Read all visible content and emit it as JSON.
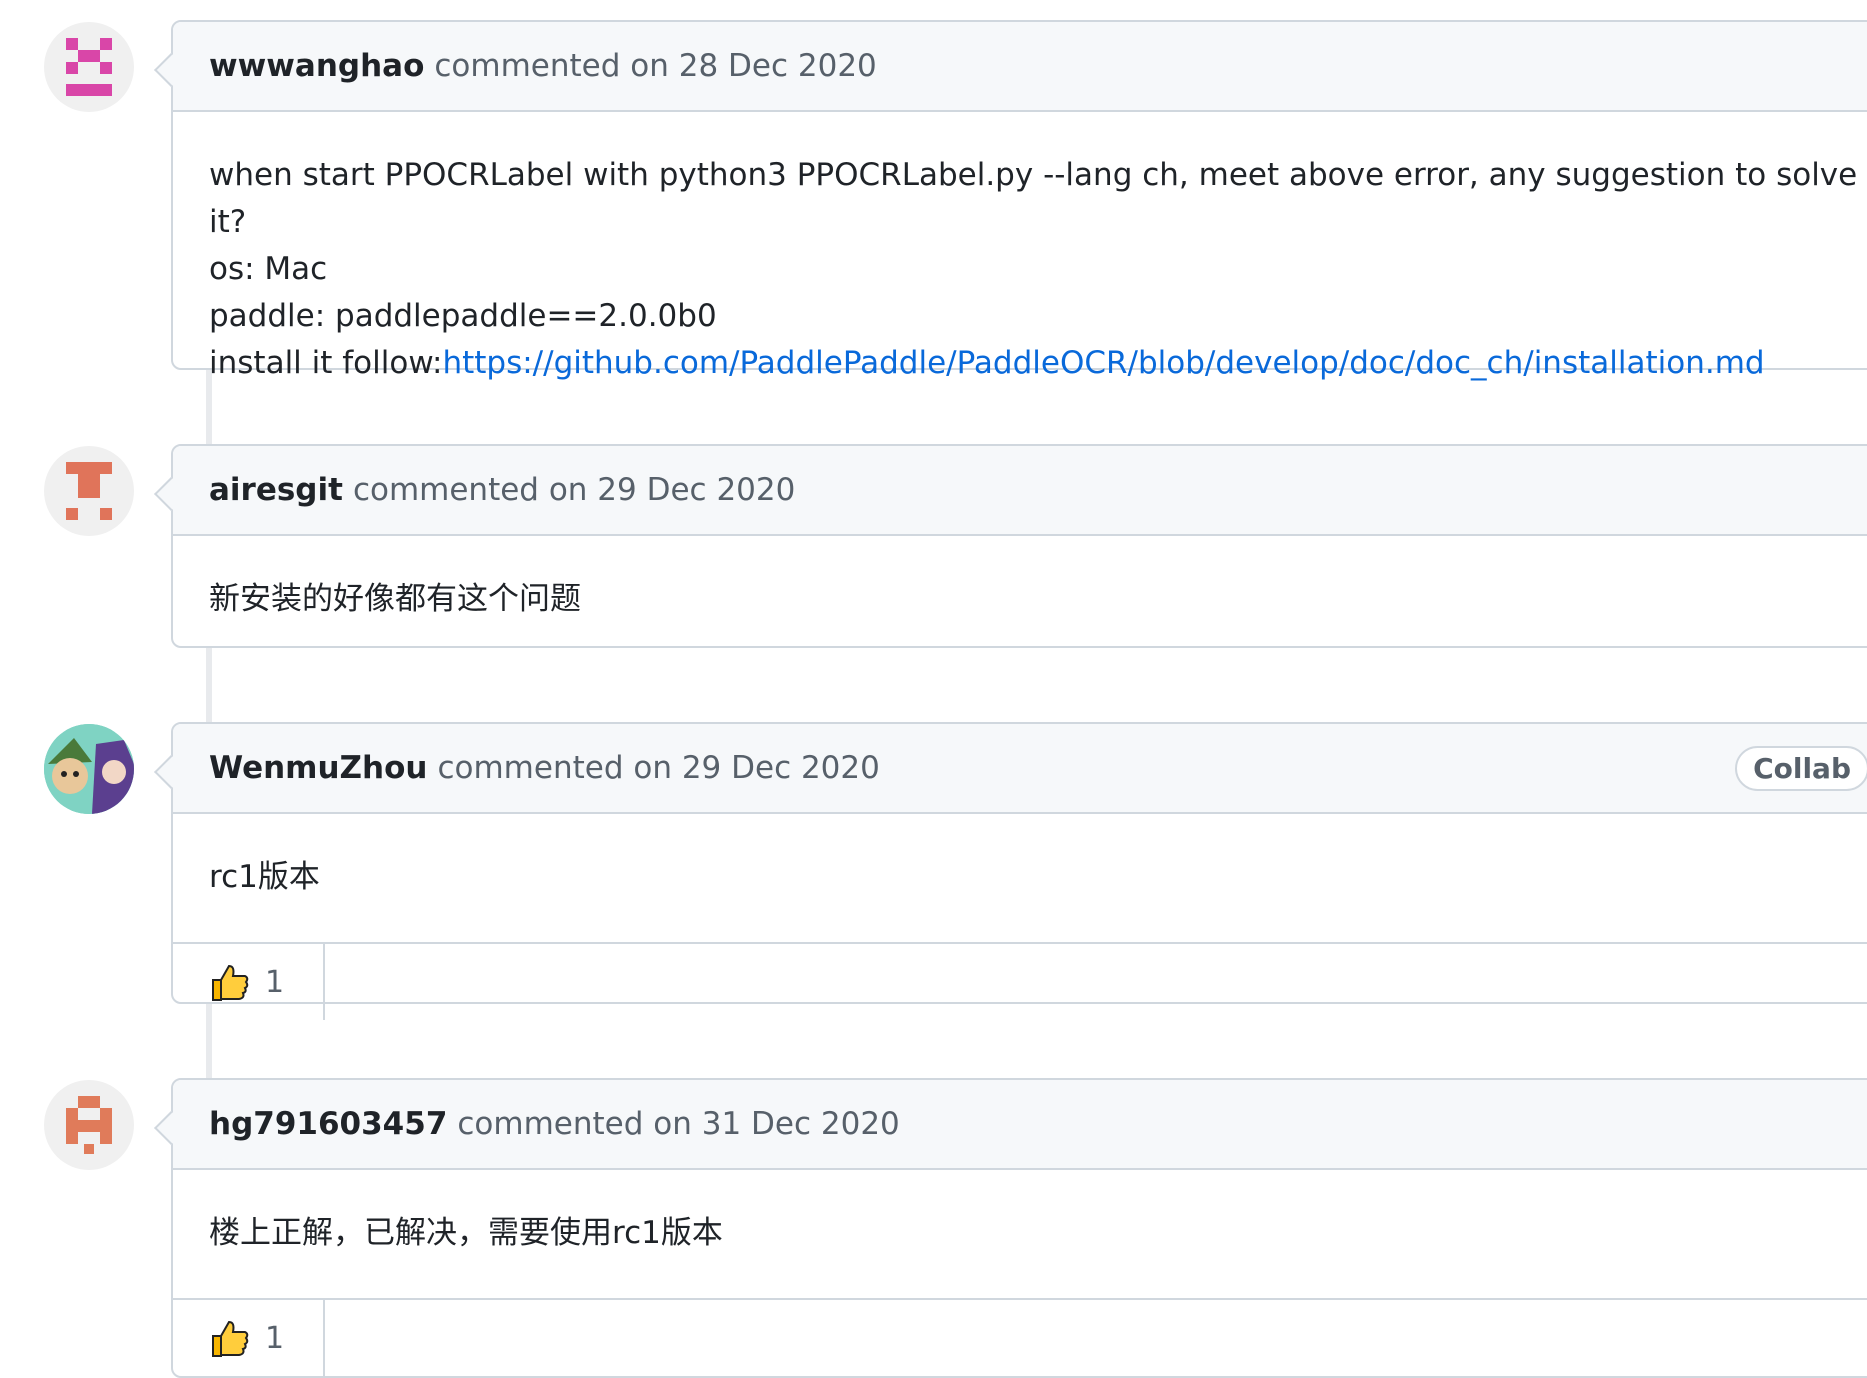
{
  "comments": [
    {
      "author": "wwwanghao",
      "meta": "commented on 28 Dec 2020",
      "body_lines": [
        "when start PPOCRLabel with python3 PPOCRLabel.py --lang ch, meet above error, any suggestion to solve it?",
        "os: Mac",
        "paddle: paddlepaddle==2.0.0b0"
      ],
      "install_prefix": "install it follow:",
      "install_link": "https://github.com/PaddlePaddle/PaddleOCR/blob/develop/doc/doc_ch/installation.md",
      "avatar_color": "#d946a8"
    },
    {
      "author": "airesgit",
      "meta": "commented on 29 Dec 2020",
      "body": "新安装的好像都有这个问题",
      "avatar_color": "#e0745a"
    },
    {
      "author": "WenmuZhou",
      "meta": "commented on 29 Dec 2020",
      "badge": "Collab",
      "body": "rc1版本",
      "reaction_icon": "thumbs-up-icon",
      "reaction_count": "1"
    },
    {
      "author": "hg791603457",
      "meta": "commented on 31 Dec 2020",
      "body": "楼上正解，已解决，需要使用rc1版本",
      "reaction_icon": "thumbs-up-icon",
      "reaction_count": "1",
      "avatar_color": "#e07b5a"
    }
  ]
}
